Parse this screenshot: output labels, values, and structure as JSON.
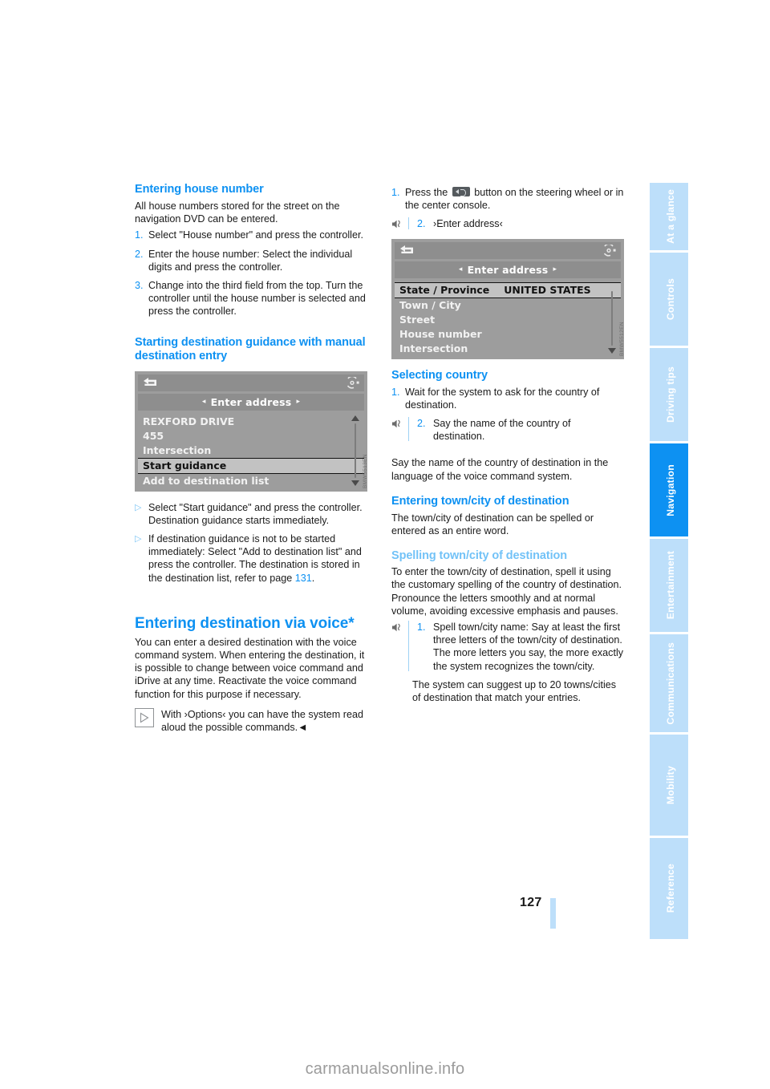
{
  "document": {
    "page_number": "127",
    "watermark": "carmanualsonline.info"
  },
  "tabs": [
    {
      "label": "At a glance",
      "active": false
    },
    {
      "label": "Controls",
      "active": false
    },
    {
      "label": "Driving tips",
      "active": false
    },
    {
      "label": "Navigation",
      "active": true
    },
    {
      "label": "Entertainment",
      "active": false
    },
    {
      "label": "Communications",
      "active": false
    },
    {
      "label": "Mobility",
      "active": false
    },
    {
      "label": "Reference",
      "active": false
    }
  ],
  "left_column": {
    "heading_house_number": "Entering house number",
    "intro_house_number": "All house numbers stored for the street on the navigation DVD can be entered.",
    "house_number_steps": [
      {
        "marker": "1.",
        "text": "Select \"House number\" and press the controller."
      },
      {
        "marker": "2.",
        "text": "Enter the house number:\nSelect the individual digits and press the controller."
      },
      {
        "marker": "3.",
        "text": "Change into the third field from the top.\nTurn the controller until the house number is selected and press the controller."
      }
    ],
    "heading_start_guidance": "Starting destination guidance with manual destination entry",
    "idrive_screen_1": {
      "title": "Enter address",
      "rows": [
        {
          "label": "REXFORD DRIVE",
          "value": "",
          "selected": false
        },
        {
          "label": "455",
          "value": "",
          "selected": false
        },
        {
          "label": "Intersection",
          "value": "",
          "selected": false
        },
        {
          "label": "Start guidance",
          "value": "",
          "selected": true
        },
        {
          "label": "Add to destination list",
          "value": "",
          "selected": false
        }
      ],
      "code": "BMW5513EN"
    },
    "start_guidance_steps": [
      {
        "marker": "▷",
        "text": "Select \"Start guidance\" and press the controller.\nDestination guidance starts immediately."
      },
      {
        "marker": "▷",
        "text": "If destination guidance is not to be started immediately:\nSelect \"Add to destination list\" and press the controller.\nThe destination is stored in the destination list, refer to page ",
        "page_ref": "131",
        "text_after": "."
      }
    ],
    "heading_voice": "Entering destination via voice*",
    "voice_intro": "You can enter a desired destination with the voice command system. When entering the destination, it is possible to change between voice command and iDrive at any time. Reactivate the voice command function for this purpose if necessary.",
    "note_text": "With ›Options‹ you can have the system read aloud the possible commands.◄"
  },
  "right_column": {
    "voice_entry_steps": [
      {
        "marker": "1.",
        "text_before": "Press the ",
        "icon": "steering-wheel-voice-button",
        "text_after": " button on the steering wheel or in the center console.",
        "has_mic": false
      },
      {
        "marker": "2.",
        "text": "›Enter address‹",
        "has_mic": true
      }
    ],
    "idrive_screen_2": {
      "title": "Enter address",
      "rows": [
        {
          "label": "State / Province",
          "value": "UNITED STATES",
          "selected": true
        },
        {
          "label": "Town / City",
          "value": "",
          "selected": false
        },
        {
          "label": "Street",
          "value": "",
          "selected": false
        },
        {
          "label": "House number",
          "value": "",
          "selected": false
        },
        {
          "label": "Intersection",
          "value": "",
          "selected": false
        }
      ],
      "code": "BMW5512EN"
    },
    "heading_selecting_country": "Selecting country",
    "country_steps": [
      {
        "marker": "1.",
        "text": "Wait for the system to ask for the country of destination.",
        "has_mic": false
      },
      {
        "marker": "2.",
        "text": "Say the name of the country of destination.",
        "has_mic": true
      }
    ],
    "country_note": "Say the name of the country of destination in the language of the voice command system.",
    "heading_town_city": "Entering town/city of destination",
    "town_city_intro": "The town/city of destination can be spelled or entered as an entire word.",
    "heading_spelling": "Spelling town/city of destination",
    "spelling_p1": "To enter the town/city of destination, spell it using the customary spelling of the country of destination.",
    "spelling_p2": "Pronounce the letters smoothly and at normal volume, avoiding excessive emphasis and pauses.",
    "spelling_steps": [
      {
        "marker": "1.",
        "text": "Spell town/city name:\nSay at least the first three letters of the town/city of destination. The more letters you say, the more exactly the system recognizes the town/city.",
        "has_mic": true
      }
    ],
    "spelling_outro": "The system can suggest up to 20 towns/cities of destination that match your entries."
  },
  "colors": {
    "heading_blue": "#0d91f2",
    "subheading_blue": "#72c2f7",
    "tab_inactive": "#bddffa",
    "tab_active": "#0d91f2"
  }
}
